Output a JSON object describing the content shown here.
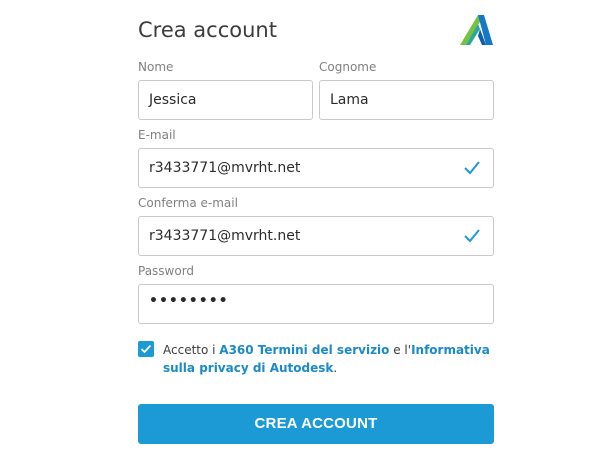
{
  "header": {
    "title": "Crea account",
    "logo_icon": "autodesk-logo"
  },
  "form": {
    "first_name": {
      "label": "Nome",
      "value": "Jessica"
    },
    "last_name": {
      "label": "Cognome",
      "value": "Lama"
    },
    "email": {
      "label": "E-mail",
      "value": "r3433771@mvrht.net",
      "valid_icon": "checkmark-icon"
    },
    "confirm_email": {
      "label": "Conferma e-mail",
      "value": "r3433771@mvrht.net",
      "valid_icon": "checkmark-icon"
    },
    "password": {
      "label": "Password",
      "value": "••••••••"
    }
  },
  "terms": {
    "checked": true,
    "text_prefix": "Accetto i ",
    "link_terms": "A360 Termini del servizio",
    "text_middle": " e l'",
    "link_privacy": "Informativa sulla privacy di Autodesk",
    "text_suffix": "."
  },
  "submit": {
    "label": "CREA ACCOUNT"
  },
  "colors": {
    "accent": "#1b9ad6",
    "link": "#1b8ac8",
    "border": "#c9c9c9"
  }
}
